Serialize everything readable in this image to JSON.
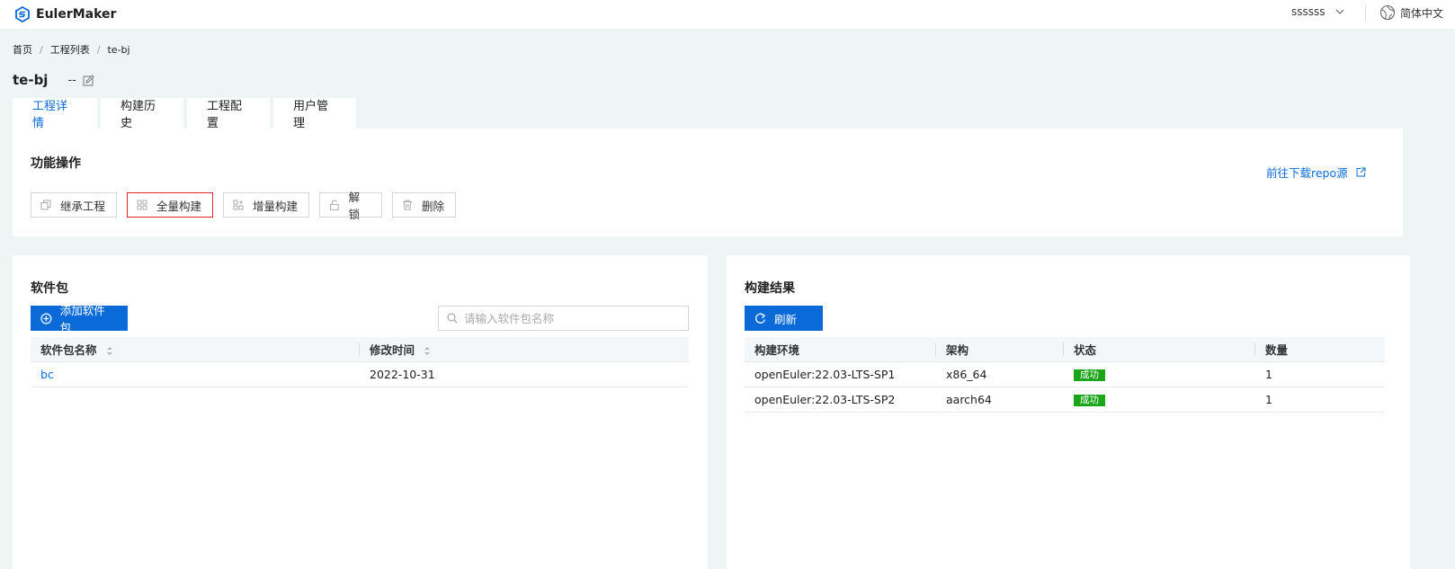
{
  "app": {
    "name": "EulerMaker"
  },
  "header": {
    "username": "ssssss",
    "language": "简体中文"
  },
  "breadcrumb": [
    "首页",
    "工程列表",
    "te-bj"
  ],
  "project": {
    "name": "te-bj",
    "description": "--"
  },
  "tabs": [
    {
      "label": "工程详情",
      "active": true
    },
    {
      "label": "构建历史",
      "active": false
    },
    {
      "label": "工程配置",
      "active": false
    },
    {
      "label": "用户管理",
      "active": false
    }
  ],
  "operations": {
    "title": "功能操作",
    "buttons": [
      {
        "label": "继承工程",
        "icon": "copy-icon"
      },
      {
        "label": "全量构建",
        "icon": "grid-icon"
      },
      {
        "label": "增量构建",
        "icon": "grid-partial-icon"
      },
      {
        "label": "解锁",
        "icon": "unlock-icon"
      },
      {
        "label": "删除",
        "icon": "trash-icon"
      }
    ],
    "repo_link": "前往下载repo源"
  },
  "packages": {
    "title": "软件包",
    "add_button": "添加软件包",
    "search_placeholder": "请输入软件包名称",
    "columns": [
      "软件包名称",
      "修改时间"
    ],
    "rows": [
      {
        "name": "bc",
        "modified": "2022-10-31"
      }
    ]
  },
  "build_results": {
    "title": "构建结果",
    "refresh_button": "刷新",
    "columns": [
      "构建环境",
      "架构",
      "状态",
      "数量"
    ],
    "rows": [
      {
        "env": "openEuler:22.03-LTS-SP1",
        "arch": "x86_64",
        "status": "成功",
        "count": "1"
      },
      {
        "env": "openEuler:22.03-LTS-SP2",
        "arch": "aarch64",
        "status": "成功",
        "count": "1"
      }
    ]
  },
  "colors": {
    "primary": "#0a6bd8",
    "success": "#1aa51a",
    "highlight_border": "#e0262b",
    "background": "#eef5f4"
  }
}
